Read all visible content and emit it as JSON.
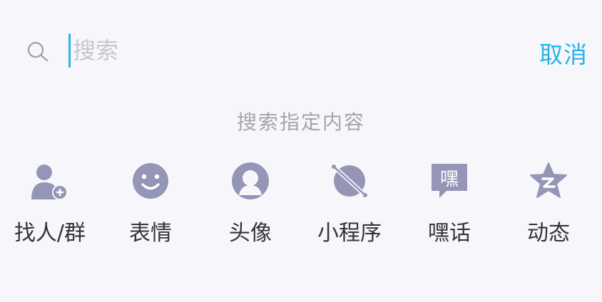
{
  "search": {
    "placeholder": "搜索",
    "cancel_label": "取消"
  },
  "section": {
    "title": "搜索指定内容"
  },
  "categories": [
    {
      "label": "找人/群",
      "icon": "add-person-icon"
    },
    {
      "label": "表情",
      "icon": "smiley-icon"
    },
    {
      "label": "头像",
      "icon": "avatar-icon"
    },
    {
      "label": "小程序",
      "icon": "planet-icon"
    },
    {
      "label": "嘿话",
      "icon": "chat-bubble-icon"
    },
    {
      "label": "动态",
      "icon": "star-z-icon"
    }
  ],
  "colors": {
    "accent": "#27b3e6",
    "icon": "#9596b6",
    "background": "#f7f7fb"
  }
}
